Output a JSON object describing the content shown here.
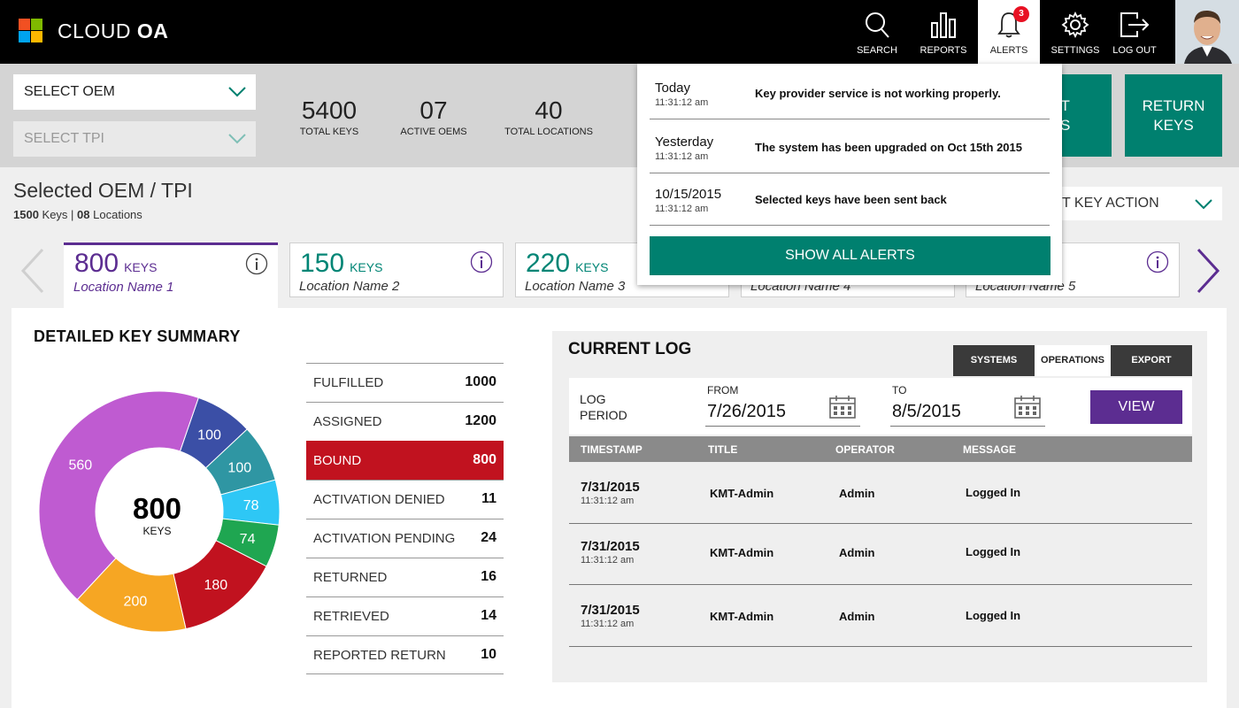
{
  "app": {
    "title_light": "CLOUD ",
    "title_bold": "OA"
  },
  "nav": {
    "search": "SEARCH",
    "reports": "REPORTS",
    "alerts": "ALERTS",
    "alerts_badge": "3",
    "settings": "SETTINGS",
    "logout": "LOG OUT"
  },
  "filters": {
    "oem": "SELECT OEM",
    "tpi": "SELECT TPI"
  },
  "stats": [
    {
      "value": "5400",
      "label": "TOTAL KEYS"
    },
    {
      "value": "07",
      "label": "ACTIVE OEMS"
    },
    {
      "value": "40",
      "label": "TOTAL LOCATIONS"
    }
  ],
  "actions": {
    "get_keys_line1": "ET",
    "get_keys_line2": "YS",
    "return_keys_line1": "RETURN",
    "return_keys_line2": "KEYS"
  },
  "selected": {
    "title": "Selected OEM / TPI",
    "keys_num": "1500",
    "keys_word": " Keys",
    "sep": " | ",
    "loc_num": "08",
    "loc_word": " Locations",
    "key_action": "T KEY ACTION"
  },
  "locations": [
    {
      "value": "800",
      "unit": "KEYS",
      "name": "Location Name 1"
    },
    {
      "value": "150",
      "unit": "KEYS",
      "name": "Location Name 2"
    },
    {
      "value": "220",
      "unit": "KEYS",
      "name": "Location Name 3"
    },
    {
      "value": "",
      "unit": "",
      "name": "Location Name 4"
    },
    {
      "value": "",
      "unit": "",
      "name": "Location Name 5"
    }
  ],
  "summary": {
    "title": "DETAILED KEY SUMMARY",
    "center_value": "800",
    "center_unit": "KEYS",
    "rows": [
      {
        "label": "FULFILLED",
        "value": "1000"
      },
      {
        "label": "ASSIGNED",
        "value": "1200"
      },
      {
        "label": "BOUND",
        "value": "800"
      },
      {
        "label": "ACTIVATION DENIED",
        "value": "11"
      },
      {
        "label": "ACTIVATION PENDING",
        "value": "24"
      },
      {
        "label": "RETURNED",
        "value": "16"
      },
      {
        "label": "RETRIEVED",
        "value": "14"
      },
      {
        "label": "REPORTED RETURN",
        "value": "10"
      }
    ]
  },
  "chart_data": {
    "type": "pie",
    "center_label": "800 KEYS",
    "values": [
      100,
      100,
      78,
      74,
      180,
      200,
      560
    ],
    "colors": [
      "#3b4fa6",
      "#2f96a3",
      "#2ec7f5",
      "#1fa651",
      "#c1121f",
      "#f6a623",
      "#bf5bd1"
    ]
  },
  "log": {
    "title": "CURRENT LOG",
    "tabs": [
      "SYSTEMS",
      "OPERATIONS",
      "EXPORT"
    ],
    "period_line1": "LOG",
    "period_line2": "PERIOD",
    "from_label": "FROM",
    "from_value": "7/26/2015",
    "to_label": "TO",
    "to_value": "8/5/2015",
    "view": "VIEW",
    "columns": [
      "TIMESTAMP",
      "TITLE",
      "OPERATOR",
      "MESSAGE"
    ],
    "rows": [
      {
        "date": "7/31/2015",
        "time": "11:31:12 am",
        "title": "KMT-Admin",
        "operator": "Admin",
        "message": "Logged In"
      },
      {
        "date": "7/31/2015",
        "time": "11:31:12 am",
        "title": "KMT-Admin",
        "operator": "Admin",
        "message": "Logged In"
      },
      {
        "date": "7/31/2015",
        "time": "11:31:12 am",
        "title": "KMT-Admin",
        "operator": "Admin",
        "message": "Logged In"
      }
    ]
  },
  "alerts": {
    "items": [
      {
        "when": "Today",
        "time": "11:31:12 am",
        "message": "Key provider service is not working properly."
      },
      {
        "when": "Yesterday",
        "time": "11:31:12 am",
        "message": "The system has been upgraded on Oct 15th 2015"
      },
      {
        "when": "10/15/2015",
        "time": "11:31:12 am",
        "message": "Selected keys have been sent back"
      }
    ],
    "show_all": "SHOW ALL ALERTS"
  }
}
